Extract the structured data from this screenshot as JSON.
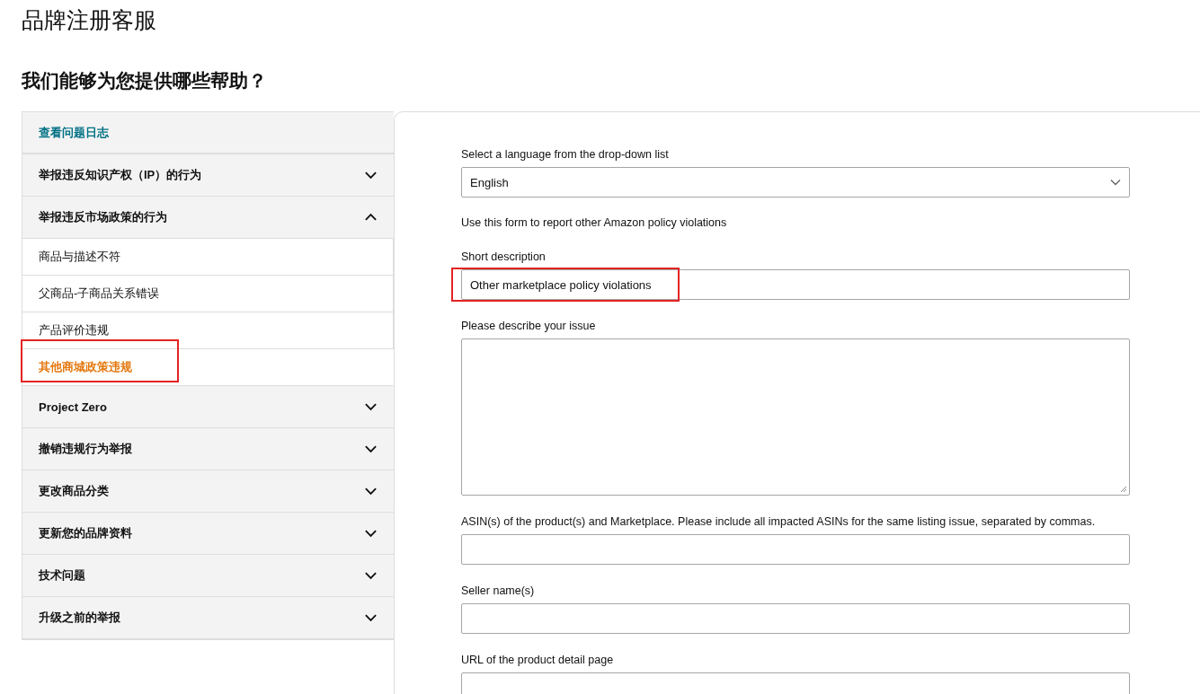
{
  "page_title": "品牌注册客服",
  "heading": "我们能够为您提供哪些帮助？",
  "sidebar": {
    "items": [
      {
        "kind": "link",
        "label": "查看问题日志"
      },
      {
        "kind": "section",
        "label": "举报违反知识产权（IP）的行为",
        "expanded": false
      },
      {
        "kind": "section",
        "label": "举报违反市场政策的行为",
        "expanded": true,
        "children": [
          {
            "label": "商品与描述不符",
            "selected": false
          },
          {
            "label": "父商品-子商品关系错误",
            "selected": false
          },
          {
            "label": "产品评价违规",
            "selected": false
          },
          {
            "label": "其他商城政策违规",
            "selected": true,
            "highlighted": true
          }
        ]
      },
      {
        "kind": "section",
        "label": "Project Zero",
        "expanded": false
      },
      {
        "kind": "section",
        "label": "撤销违规行为举报",
        "expanded": false
      },
      {
        "kind": "section",
        "label": "更改商品分类",
        "expanded": false
      },
      {
        "kind": "section",
        "label": "更新您的品牌资料",
        "expanded": false
      },
      {
        "kind": "section",
        "label": "技术问题",
        "expanded": false
      },
      {
        "kind": "section",
        "label": "升级之前的举报",
        "expanded": false
      }
    ]
  },
  "form": {
    "fields": [
      {
        "kind": "select",
        "label": "Select a language from the drop-down list",
        "value": "English"
      },
      {
        "kind": "note",
        "text": "Use this form to report other Amazon policy violations"
      },
      {
        "kind": "text",
        "label": "Short description",
        "value": "Other marketplace policy violations",
        "highlighted": true
      },
      {
        "kind": "textarea",
        "label": "Please describe your issue"
      },
      {
        "kind": "text",
        "label": "ASIN(s) of the product(s) and Marketplace. Please include all impacted ASINs for the same listing issue, separated by commas."
      },
      {
        "kind": "text",
        "label": "Seller name(s)"
      },
      {
        "kind": "text",
        "label": "URL of the product detail page"
      }
    ]
  }
}
